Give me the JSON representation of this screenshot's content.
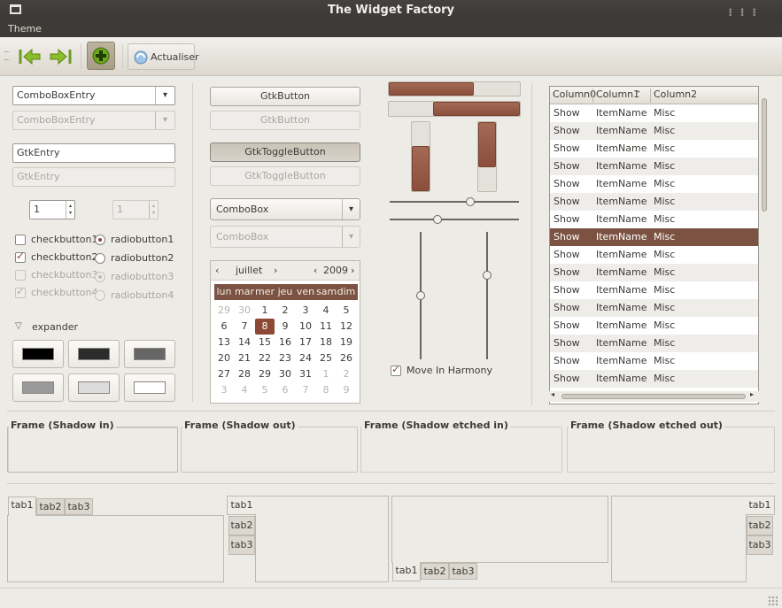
{
  "window": {
    "title": "The Widget Factory"
  },
  "menubar": {
    "theme": "Theme"
  },
  "toolbar": {
    "refresh_label": "Actualiser"
  },
  "col1": {
    "comboentry_value": "ComboBoxEntry",
    "comboentry_dis_value": "ComboBoxEntry",
    "entry_value": "GtkEntry",
    "entry_dis_value": "GtkEntry",
    "spin_value": "1",
    "spin_dis_value": "1",
    "checks": [
      "checkbutton1",
      "checkbutton2",
      "checkbutton3",
      "checkbutton4"
    ],
    "radios": [
      "radiobutton1",
      "radiobutton2",
      "radiobutton3",
      "radiobutton4"
    ],
    "expander": "expander",
    "swatch_colors": [
      "#000000",
      "#2c2c2c",
      "#666666",
      "#9a9a9a",
      "#dcdcdc",
      "#ffffff"
    ]
  },
  "col2": {
    "button": "GtkButton",
    "button_dis": "GtkButton",
    "toggle": "GtkToggleButton",
    "toggle_dis": "GtkToggleButton",
    "combo": "ComboBox",
    "combo_dis": "ComboBox",
    "calendar": {
      "month": "juillet",
      "year": "2009",
      "weekdays": [
        "lun",
        "mar",
        "mer",
        "jeu",
        "ven",
        "sam",
        "dim"
      ],
      "weeks": [
        [
          "29",
          "30",
          "1",
          "2",
          "3",
          "4",
          "5"
        ],
        [
          "6",
          "7",
          "8",
          "9",
          "10",
          "11",
          "12"
        ],
        [
          "13",
          "14",
          "15",
          "16",
          "17",
          "18",
          "19"
        ],
        [
          "20",
          "21",
          "22",
          "23",
          "24",
          "25",
          "26"
        ],
        [
          "27",
          "28",
          "29",
          "30",
          "31",
          "1",
          "2"
        ],
        [
          "3",
          "4",
          "5",
          "6",
          "7",
          "8",
          "9"
        ]
      ],
      "selected": "8"
    }
  },
  "col3": {
    "harmony_label": "Move In Harmony",
    "hbar1_progress": 0.65,
    "hbar2_progress": 0.66,
    "vbar1_progress": 0.65,
    "vbar2_progress": 0.65,
    "hscale1_value": 0.63,
    "hscale2_value": 0.36,
    "vscale1_value": 0.5,
    "vscale2_value": 0.33
  },
  "tree": {
    "columns": [
      "Column0",
      "Column1",
      "Column2"
    ],
    "rows": [
      [
        "Show",
        "ItemName",
        "Misc"
      ],
      [
        "Show",
        "ItemName",
        "Misc"
      ],
      [
        "Show",
        "ItemName",
        "Misc"
      ],
      [
        "Show",
        "ItemName",
        "Misc"
      ],
      [
        "Show",
        "ItemName",
        "Misc"
      ],
      [
        "Show",
        "ItemName",
        "Misc"
      ],
      [
        "Show",
        "ItemName",
        "Misc"
      ],
      [
        "Show",
        "ItemName",
        "Misc"
      ],
      [
        "Show",
        "ItemName",
        "Misc"
      ],
      [
        "Show",
        "ItemName",
        "Misc"
      ],
      [
        "Show",
        "ItemName",
        "Misc"
      ],
      [
        "Show",
        "ItemName",
        "Misc"
      ],
      [
        "Show",
        "ItemName",
        "Misc"
      ],
      [
        "Show",
        "ItemName",
        "Misc"
      ],
      [
        "Show",
        "ItemName",
        "Misc"
      ],
      [
        "Show",
        "ItemName",
        "Misc"
      ]
    ],
    "selected_row": 7
  },
  "frames": [
    "Frame (Shadow in)",
    "Frame (Shadow out)",
    "Frame (Shadow etched in)",
    "Frame (Shadow etched out)"
  ],
  "notebooks": {
    "tabs": [
      "tab1",
      "tab2",
      "tab3"
    ]
  },
  "colors": {
    "accent": "#8c4a36",
    "selected_row": "#7c5343"
  }
}
